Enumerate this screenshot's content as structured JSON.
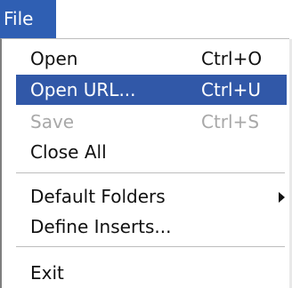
{
  "menu_bar": {
    "active_menu": "File"
  },
  "file_menu": {
    "items": [
      {
        "label": "Open",
        "shortcut": "Ctrl+O",
        "state": "normal"
      },
      {
        "label": "Open URL...",
        "shortcut": "Ctrl+U",
        "state": "highlighted"
      },
      {
        "label": "Save",
        "shortcut": "Ctrl+S",
        "state": "disabled"
      },
      {
        "label": "Close All",
        "shortcut": "",
        "state": "normal"
      },
      {
        "label": "Default Folders",
        "shortcut": "",
        "state": "normal",
        "submenu_icon": "submenu-arrow-icon"
      },
      {
        "label": "Define Inserts...",
        "shortcut": "",
        "state": "normal"
      },
      {
        "label": "Exit",
        "shortcut": "",
        "state": "normal"
      }
    ]
  },
  "colors": {
    "title_bg": "#2f5fb3",
    "highlight_bg": "#3158a8",
    "disabled_text": "#a8a8a8",
    "text": "#111111"
  }
}
